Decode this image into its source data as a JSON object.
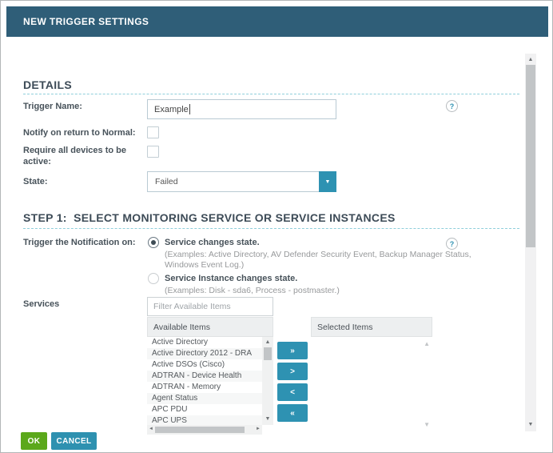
{
  "window": {
    "title": "NEW TRIGGER SETTINGS"
  },
  "icons": {
    "help": "?",
    "caret_down": "▼",
    "up": "▲",
    "down": "▼",
    "left": "◄",
    "right": "►"
  },
  "details": {
    "heading": "DETAILS",
    "trigger_name_label": "Trigger Name:",
    "trigger_name_value": "Example",
    "notify_label": "Notify on return to Normal:",
    "notify_checked": false,
    "require_label": "Require all devices to be active:",
    "require_checked": false,
    "state_label": "State:",
    "state_value": "Failed"
  },
  "step1": {
    "heading": "STEP 1:  SELECT MONITORING SERVICE OR SERVICE INSTANCES",
    "trigger_on_label": "Trigger the Notification on:",
    "option1_label": "Service changes state.",
    "option1_selected": true,
    "option1_example_line1": "(Examples: Active Directory, AV Defender Security Event, Backup Manager Status,",
    "option1_example_line2": "Windows Event Log.)",
    "option2_label": "Service Instance changes state.",
    "option2_selected": false,
    "option2_example": "(Examples: Disk - sda6, Process - postmaster.)",
    "services_label": "Services",
    "filter_placeholder": "Filter Available Items",
    "available_header": "Available Items",
    "selected_header": "Selected Items",
    "available_items": [
      "Active Directory",
      "Active Directory 2012 - DRA",
      "Active DSOs (Cisco)",
      "ADTRAN - Device Health",
      "ADTRAN - Memory",
      "Agent Status",
      "APC PDU",
      "APC UPS"
    ],
    "selected_items": [],
    "transfer": {
      "all_right": "»",
      "one_right": ">",
      "one_left": "<",
      "all_left": "«"
    }
  },
  "footer": {
    "ok": "OK",
    "cancel": "CANCEL"
  },
  "colors": {
    "header_bar": "#2f5e78",
    "accent_teal": "#2e92b2",
    "ok_green": "#5ba81b",
    "divider": "#8fcfdb"
  }
}
